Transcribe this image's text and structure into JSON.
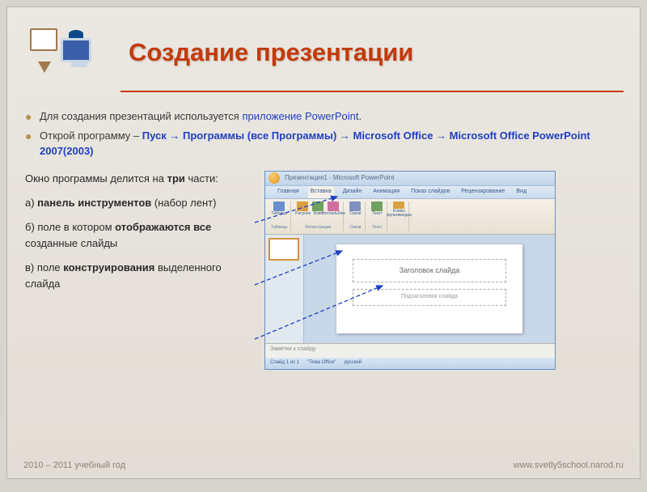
{
  "title": "Создание презентации",
  "bullets": [
    {
      "pre": "Для создания презентаций используется ",
      "hl": "приложение PowerPoint",
      "post": "."
    },
    {
      "pre": "Открой программу – ",
      "hl": "Пуск → Программы  (все Программы) → Microsoft Office → Microsoft Office PowerPoint 2007(2003)",
      "post": ""
    }
  ],
  "window_intro": "Окно программы делится на ",
  "window_bold": "три",
  "window_post": " части:",
  "parts": [
    {
      "letter": "а) ",
      "bold": "панель инструментов",
      "rest": " (набор лент)"
    },
    {
      "letter": "б) ",
      "pre": "поле в котором ",
      "bold": "отображаются все",
      "rest": " созданные слайды"
    },
    {
      "letter": "в) ",
      "pre": "поле ",
      "bold": "конструирования",
      "rest": " выделенного слайда"
    }
  ],
  "pp": {
    "titlebar": "Презентация1 - Microsoft PowerPoint",
    "tabs": [
      "Главная",
      "Вставка",
      "Дизайн",
      "Анимация",
      "Показ слайдов",
      "Рецензирование",
      "Вид"
    ],
    "active_tab": 1,
    "ribbon_groups": [
      {
        "label": "Таблицы",
        "icons": [
          {
            "label": "Таблица",
            "color": "#6a8fd0"
          }
        ]
      },
      {
        "label": "Иллюстрации",
        "icons": [
          {
            "label": "Рисунок",
            "color": "#d8a040"
          },
          {
            "label": "Клип",
            "color": "#70a060"
          },
          {
            "label": "Фотоальбом",
            "color": "#d070a0"
          }
        ]
      },
      {
        "label": "Связи",
        "icons": [
          {
            "label": "Связи",
            "color": "#8090c0"
          }
        ]
      },
      {
        "label": "Текст",
        "icons": [
          {
            "label": "Текст",
            "color": "#70a060"
          }
        ]
      },
      {
        "label": "",
        "icons": [
          {
            "label": "Клипы мультимедиа",
            "color": "#d8a040"
          }
        ]
      }
    ],
    "slide_title": "Заголовок слайда",
    "slide_sub": "Подзаголовок слайда",
    "notes": "Заметки к слайду",
    "status": {
      "slide": "Слайд 1 из 1",
      "theme": "\"Тема Office\"",
      "lang": "русский"
    }
  },
  "footer": {
    "left": "2010 – 2011 учебный год",
    "right": "www.svetly5school.narod.ru"
  }
}
